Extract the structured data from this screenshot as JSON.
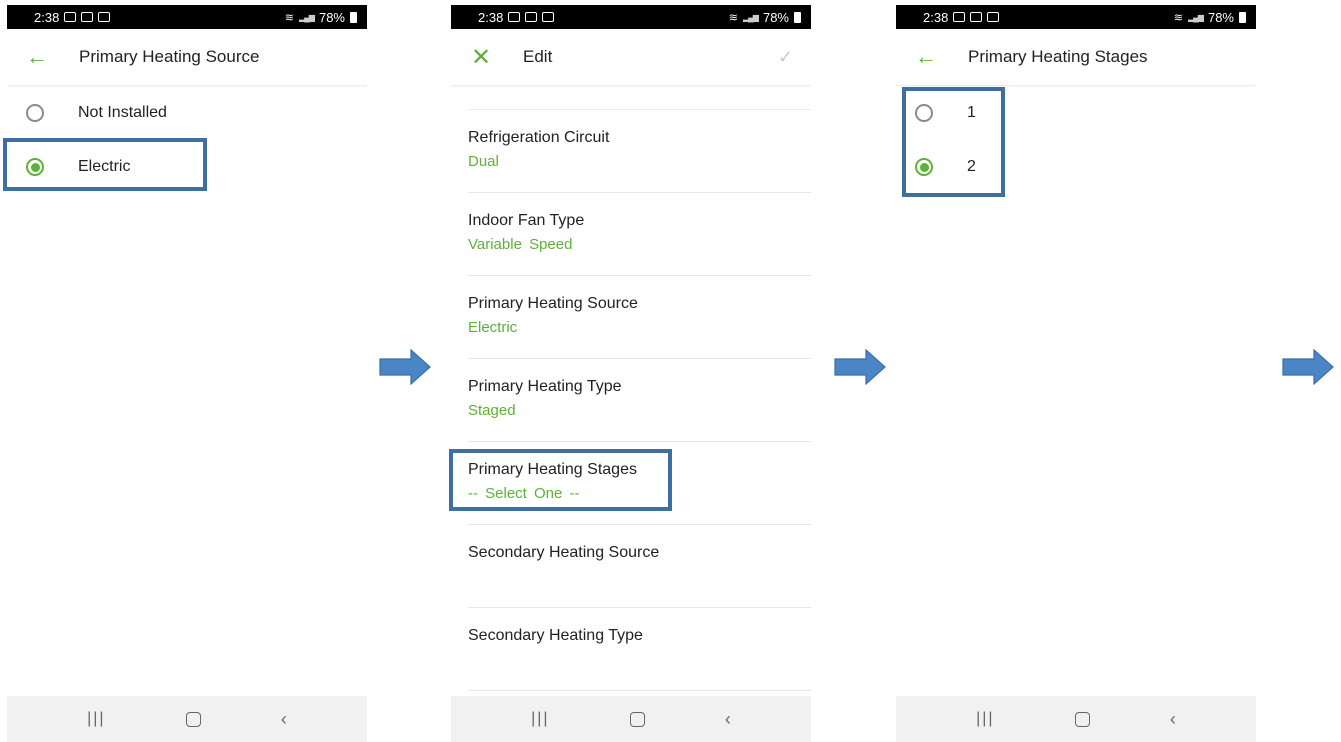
{
  "status_bar": {
    "time": "2:38",
    "battery": "78%"
  },
  "screen1": {
    "title": "Primary Heating Source",
    "options": [
      {
        "label": "Not Installed",
        "selected": false
      },
      {
        "label": "Electric",
        "selected": true
      }
    ]
  },
  "screen2": {
    "title": "Edit",
    "items": [
      {
        "label": "Refrigeration Circuit",
        "value": "Dual"
      },
      {
        "label": "Indoor Fan Type",
        "value": "Variable Speed"
      },
      {
        "label": "Primary Heating Source",
        "value": "Electric"
      },
      {
        "label": "Primary Heating Type",
        "value": "Staged"
      },
      {
        "label": "Primary Heating Stages",
        "value": "-- Select One --"
      },
      {
        "label": "Secondary Heating Source",
        "value": ""
      },
      {
        "label": "Secondary Heating Type",
        "value": ""
      }
    ]
  },
  "screen3": {
    "title": "Primary Heating Stages",
    "options": [
      {
        "label": "1",
        "selected": false
      },
      {
        "label": "2",
        "selected": true
      }
    ]
  },
  "colors": {
    "accent": "#5db13a",
    "highlight": "#3d6fa3",
    "arrow": "#4a86c5"
  },
  "icons": [
    "back-arrow-icon",
    "close-icon",
    "check-icon",
    "recent-apps-icon",
    "home-icon",
    "back-icon",
    "flow-arrow-icon"
  ]
}
